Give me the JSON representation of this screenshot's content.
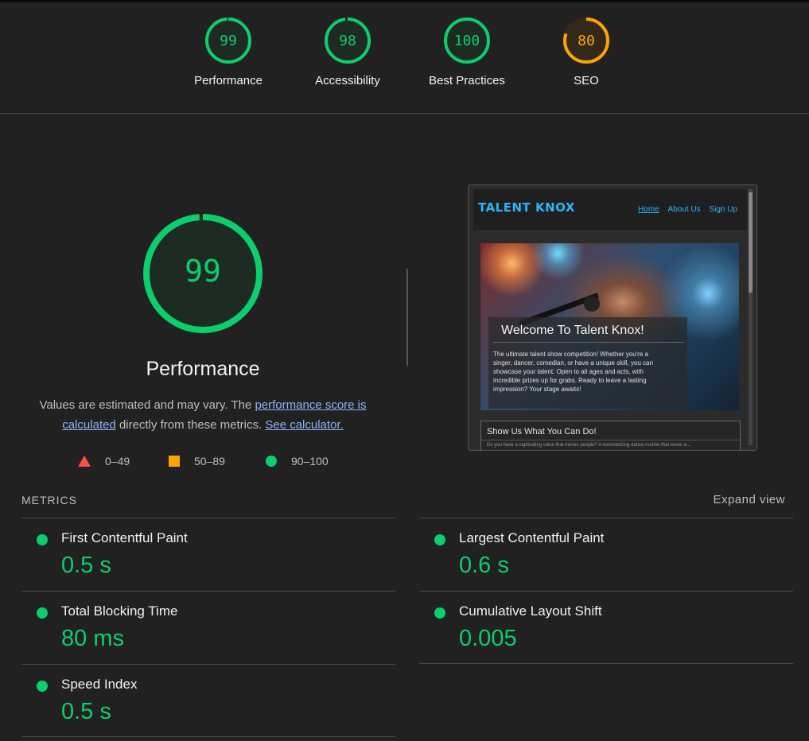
{
  "scores": [
    {
      "label": "Performance",
      "value": "99",
      "color": "#0cce6b",
      "fill": 0.99
    },
    {
      "label": "Accessibility",
      "value": "98",
      "color": "#0cce6b",
      "fill": 0.98
    },
    {
      "label": "Best Practices",
      "value": "100",
      "color": "#0cce6b",
      "fill": 1.0
    },
    {
      "label": "SEO",
      "value": "80",
      "color": "#ffa400",
      "fill": 0.8
    }
  ],
  "main": {
    "score": "99",
    "title": "Performance",
    "desc_part1": "Values are estimated and may vary. The ",
    "desc_link1": "performance score is calculated",
    "desc_part2": " directly from these metrics. ",
    "desc_link2": "See calculator."
  },
  "legend": [
    {
      "range": "0–49",
      "shape": "triangle",
      "color": "#ff4e42"
    },
    {
      "range": "50–89",
      "shape": "square",
      "color": "#ffa400"
    },
    {
      "range": "90–100",
      "shape": "circle",
      "color": "#0cce6b"
    }
  ],
  "screenshot": {
    "logo": "TALENT KNOX",
    "nav": [
      "Home",
      "About Us",
      "Sign Up"
    ],
    "hero_title": "Welcome To Talent Knox!",
    "hero_text": "The ultimate talent show competition! Whether you're a singer, dancer, comedian, or have a unique skill, you can showcase your talent. Open to all ages and acts, with incredible prizes up for grabs. Ready to leave a lasting impression? Your stage awaits!",
    "card_title": "Show Us What You Can Do!",
    "card_text": "Do you have a captivating voice that moves people? A mesmerizing dance routine that wows a..."
  },
  "metrics_header": "METRICS",
  "expand_label": "Expand view",
  "metrics": [
    {
      "name": "First Contentful Paint",
      "value": "0.5 s"
    },
    {
      "name": "Largest Contentful Paint",
      "value": "0.6 s"
    },
    {
      "name": "Total Blocking Time",
      "value": "80 ms"
    },
    {
      "name": "Cumulative Layout Shift",
      "value": "0.005"
    },
    {
      "name": "Speed Index",
      "value": "0.5 s"
    }
  ]
}
